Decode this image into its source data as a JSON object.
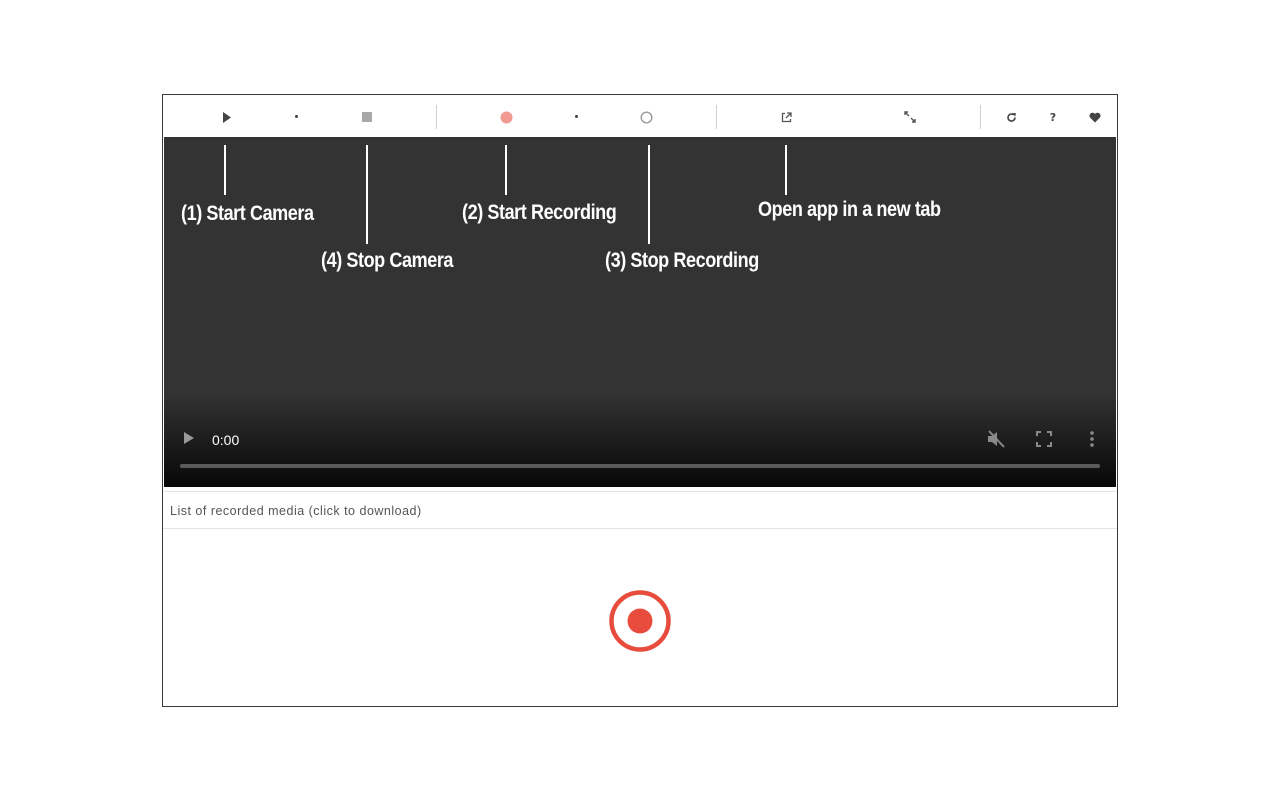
{
  "toolbar": {
    "buttons": [
      {
        "name": "start-camera",
        "icon": "play-icon"
      },
      {
        "name": "stop-camera",
        "icon": "stop-square-icon"
      },
      {
        "name": "start-recording",
        "icon": "record-dot-icon",
        "color": "#f29b92"
      },
      {
        "name": "stop-recording",
        "icon": "ring-icon"
      },
      {
        "name": "open-new-tab",
        "icon": "external-link-icon"
      },
      {
        "name": "expand",
        "icon": "expand-arrows-icon"
      },
      {
        "name": "reload",
        "icon": "reload-icon"
      },
      {
        "name": "help",
        "icon": "question-icon"
      },
      {
        "name": "favorite",
        "icon": "heart-icon"
      }
    ]
  },
  "video": {
    "time": "0:00",
    "background": "#333333"
  },
  "annotations": {
    "start_camera": "(1) Start Camera",
    "stop_camera": "(4) Stop Camera",
    "start_recording": "(2) Start Recording",
    "stop_recording": "(3) Stop Recording",
    "open_new_tab": "Open app in a new tab"
  },
  "media_list": {
    "label": "List of recorded media (click to download)"
  },
  "colors": {
    "record_accent": "#e74c3c",
    "record_light": "#f29b92"
  }
}
